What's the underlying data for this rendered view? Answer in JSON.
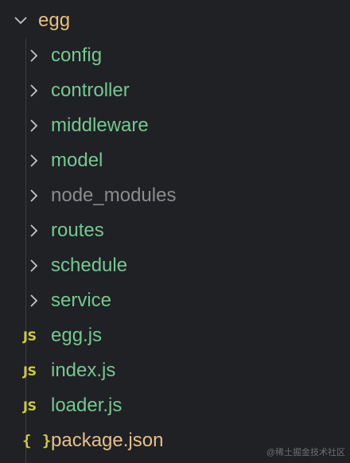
{
  "explorer": {
    "root": {
      "label": "egg",
      "icon": "chevron-down-icon",
      "expanded": true
    },
    "folders": [
      {
        "label": "config",
        "icon": "chevron-right-icon",
        "ignored": false
      },
      {
        "label": "controller",
        "icon": "chevron-right-icon",
        "ignored": false
      },
      {
        "label": "middleware",
        "icon": "chevron-right-icon",
        "ignored": false
      },
      {
        "label": "model",
        "icon": "chevron-right-icon",
        "ignored": false
      },
      {
        "label": "node_modules",
        "icon": "chevron-right-icon",
        "ignored": true
      },
      {
        "label": "routes",
        "icon": "chevron-right-icon",
        "ignored": false
      },
      {
        "label": "schedule",
        "icon": "chevron-right-icon",
        "ignored": false
      },
      {
        "label": "service",
        "icon": "chevron-right-icon",
        "ignored": false
      }
    ],
    "files": [
      {
        "label": "egg.js",
        "icon_text": "JS",
        "icon": "javascript-file-icon"
      },
      {
        "label": "index.js",
        "icon_text": "JS",
        "icon": "javascript-file-icon"
      },
      {
        "label": "loader.js",
        "icon_text": "JS",
        "icon": "javascript-file-icon"
      },
      {
        "label": "package.json",
        "icon_text": "{ }",
        "icon": "json-file-icon"
      }
    ]
  },
  "watermark": "@稀土掘金技术社区",
  "colors": {
    "background": "#202124",
    "folder_text": "#73c991",
    "ignored_text": "#8c8c8c",
    "root_text": "#e6c07b",
    "json_text": "#e2c08d",
    "js_icon": "#cbcb41"
  }
}
